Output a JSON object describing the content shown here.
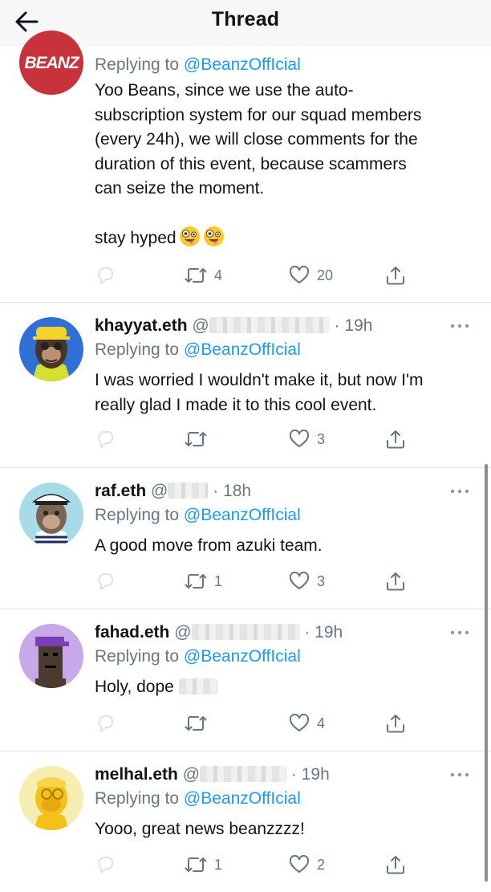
{
  "header": {
    "title": "Thread"
  },
  "tweets": [
    {
      "avatar_label": "BEANZ",
      "name": "",
      "handle": "",
      "time": "",
      "replying_label": "Replying to",
      "replying_to": "@BeanzOffIcial",
      "text": "Yoo Beans, since we use the auto-\nsubscription system for our squad members\n(every 24h), we will close comments for the\nduration of this event, because scammers\ncan seize the moment.\n\nstay hyped",
      "emoji": [
        "zany-face-emoji",
        "zany-face-emoji"
      ],
      "retweets": "4",
      "likes": "20"
    },
    {
      "name": "khayyat.eth",
      "handle": "@",
      "time": "· 19h",
      "replying_label": "Replying to",
      "replying_to": "@BeanzOffIcial",
      "text": "I was worried I wouldn't make it, but now I'm\nreally glad I made it to this cool event.",
      "retweets": "",
      "likes": "3"
    },
    {
      "name": "raf.eth",
      "handle": "@",
      "time": "· 18h",
      "replying_label": "Replying to",
      "replying_to": "@BeanzOffIcial",
      "text": "A good move from azuki team.",
      "retweets": "1",
      "likes": "3"
    },
    {
      "name": "fahad.eth",
      "handle": "@",
      "time": "· 19h",
      "replying_label": "Replying to",
      "replying_to": "@BeanzOffIcial",
      "text": "Holy, dope",
      "retweets": "",
      "likes": "4"
    },
    {
      "name": "melhal.eth",
      "handle": "@",
      "time": "· 19h",
      "replying_label": "Replying to",
      "replying_to": "@BeanzOffIcial",
      "text": "Yooo, great news beanzzzz!",
      "retweets": "1",
      "likes": "2"
    }
  ],
  "colors": {
    "link": "#1d9bf0",
    "muted": "#687684",
    "text": "#0f1419",
    "header_bg": "#f7f7f7",
    "beanz_red": "#c8323a"
  },
  "icons": [
    "back-arrow-icon",
    "reply-icon",
    "retweet-icon",
    "like-icon",
    "share-icon",
    "more-icon"
  ]
}
